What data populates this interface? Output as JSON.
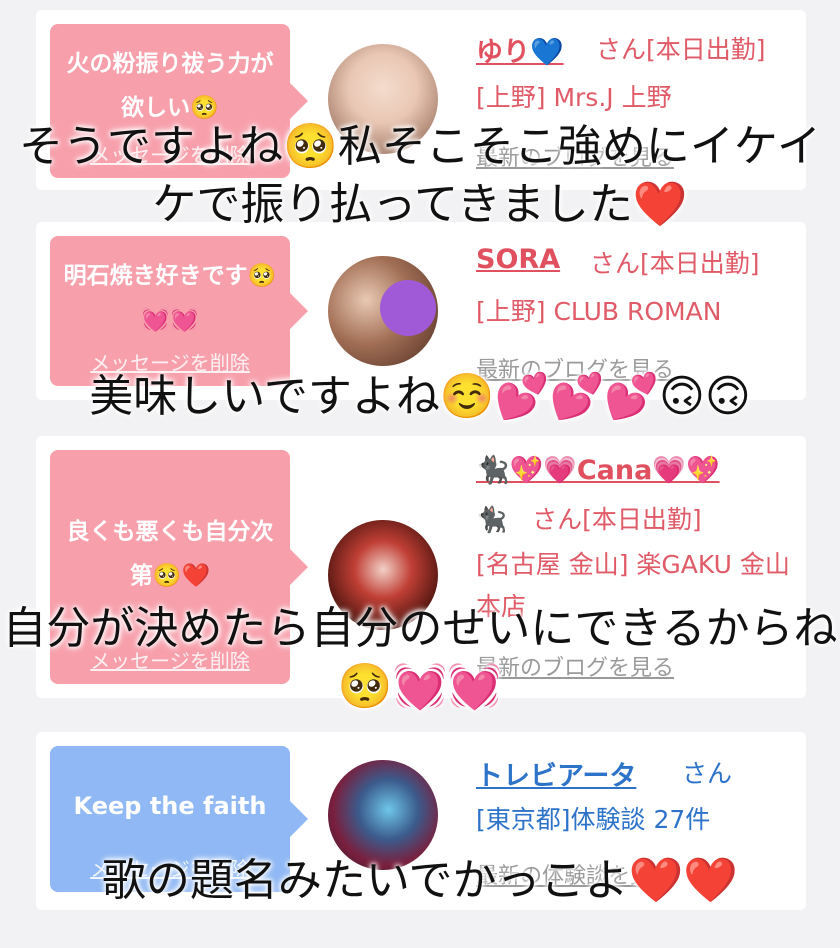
{
  "cards": [
    {
      "bubble_text": "火の粉振り祓う力が欲しい🥺",
      "delete_label": "メッセージを削除",
      "name": "ゆり💙",
      "san": "さん[本日出勤]",
      "shop": "[上野] Mrs.J 上野",
      "blog": "最新のブログを見る"
    },
    {
      "bubble_text": "明石焼き好きです🥺💓💓",
      "delete_label": "メッセージを削除",
      "name": "SORA",
      "san": "さん[本日出勤]",
      "shop": "[上野] CLUB ROMAN",
      "blog": "最新のブログを見る"
    },
    {
      "bubble_text": "良くも悪くも自分次第🥺❤️",
      "delete_label": "メッセージを削除",
      "name": "🐈‍⬛💖💗Cana💗💖",
      "san": "🐈‍⬛　さん[本日出勤]",
      "shop": "[名古屋 金山] 楽GAKU 金山本店",
      "blog": "最新のブログを見る"
    },
    {
      "bubble_text": "Keep the faith",
      "delete_label": "メッセージを削除",
      "name": "トレビアータ",
      "san": "さん",
      "shop": "[東京都]体験談 27件",
      "blog": "最新の体験談を見る"
    }
  ],
  "captions": [
    "そうですよね🥺私そこそこ強めにイケイケで振り払ってきました❤️",
    "美味しいですよね☺️💕💕💕🙃🙃",
    "自分が決めたら自分のせいにできるからね🥺💓💓",
    "歌の題名みたいでかっこよ❤️❤️"
  ],
  "colors": {
    "bubble_pink": "#f7a0ac",
    "bubble_blue": "#8fb8f4",
    "name_pink": "#e0505f",
    "name_blue": "#2d73c9"
  }
}
